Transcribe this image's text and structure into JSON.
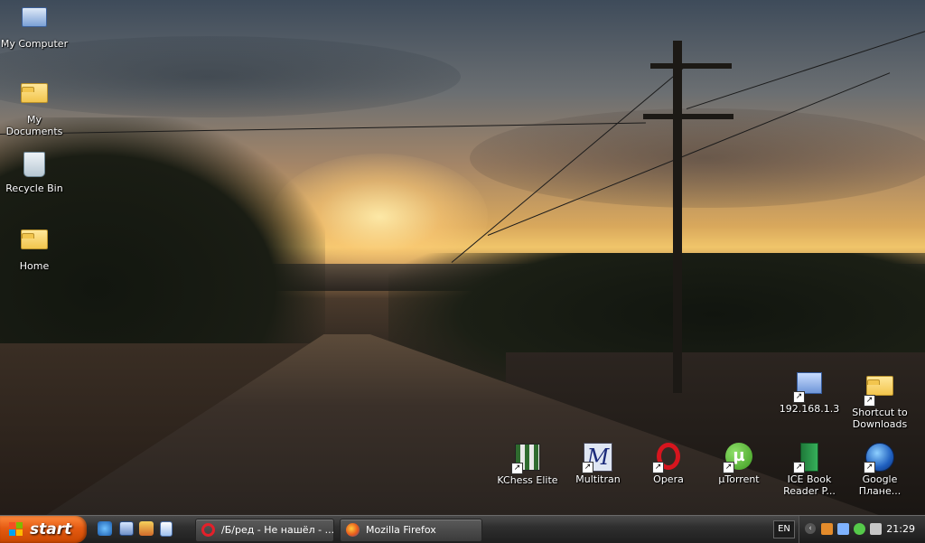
{
  "desktop": {
    "icons": [
      {
        "label": "My Computer",
        "icon": "my-computer-icon"
      },
      {
        "label": "My Documents",
        "icon": "my-documents-icon"
      },
      {
        "label": "Recycle Bin",
        "icon": "recycle-bin-icon"
      },
      {
        "label": "Home",
        "icon": "folder-icon"
      },
      {
        "label": "192.168.1.3",
        "icon": "network-computer-icon"
      },
      {
        "label": "Shortcut to Downloads",
        "icon": "folder-icon"
      },
      {
        "label": "KChess Elite",
        "icon": "kchess-icon"
      },
      {
        "label": "Multitran",
        "icon": "multitran-icon"
      },
      {
        "label": "Opera",
        "icon": "opera-icon"
      },
      {
        "label": "µTorrent",
        "icon": "utorrent-icon"
      },
      {
        "label": "ICE Book Reader P...",
        "icon": "ice-book-reader-icon"
      },
      {
        "label": "Google Плане...",
        "icon": "google-earth-icon"
      }
    ]
  },
  "taskbar": {
    "start_label": "start",
    "quick_launch": [
      "internet-explorer-icon",
      "show-desktop-icon",
      "paint-icon",
      "document-icon"
    ],
    "tasks": [
      {
        "label": "/Б/ред - Не нашёл - ...",
        "icon": "opera-icon"
      },
      {
        "label": "Mozilla Firefox",
        "icon": "firefox-icon"
      }
    ],
    "language": "EN",
    "clock": "21:29"
  },
  "colors": {
    "start_button": "#e55b12",
    "taskbar": "#2f2f2f"
  }
}
